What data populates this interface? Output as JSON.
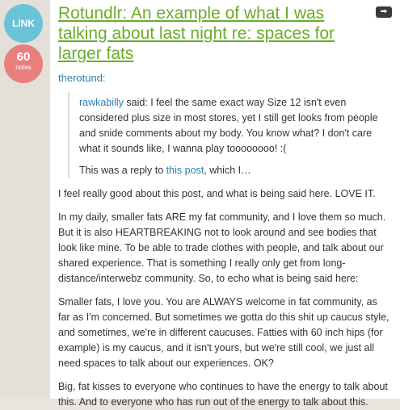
{
  "sidebar": {
    "link_label": "LINK",
    "notes_count": "60",
    "notes_label": "notes"
  },
  "post": {
    "title": "Rotundlr: An example of what I was talking about last night re: spaces for larger fats",
    "source_user": "therotund:",
    "quote": {
      "username": "rawkabilly",
      "text": " said: I feel the same exact way Size 12 isn't even considered plus size in most stores, yet I still get looks from people and snide comments about my body. You know what? I don't care what it sounds like, I wanna play toooooooo! :(",
      "reply_prefix": "This was a reply to ",
      "reply_link": "this post",
      "reply_suffix": ", which I…"
    },
    "paragraphs": [
      "I feel really good about this post, and what is being said here. LOVE IT.",
      "In my daily, smaller fats ARE my fat community, and I love them so much. But it is also HEARTBREAKING not to look around and see bodies that look like mine. To be able to trade clothes with people, and talk about our shared experience. That is something I really only get from long-distance/interwebz community. So, to echo what is being said here:",
      "Smaller fats, I love you. You are ALWAYS welcome in fat community, as far as I'm concerned. But sometimes we gotta do this shit up caucus style, and sometimes, we're in different caucuses. Fatties with 60 inch hips (for example) is my caucus, and it isn't yours, but we're still cool, we just all need spaces to talk about our experiences. OK?",
      "Big, fat kisses to everyone who continues to have the energy to talk about this. And to everyone who has run out of the energy to talk about this."
    ]
  },
  "icons": {
    "share": "arrow-right-icon"
  }
}
